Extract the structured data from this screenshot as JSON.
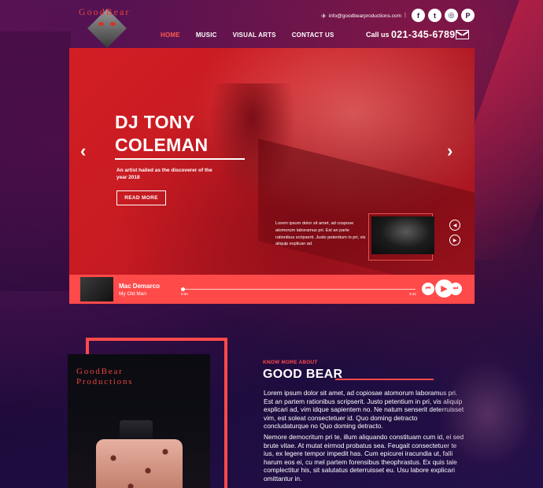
{
  "header": {
    "logo_text": "GoodBear",
    "nav": [
      {
        "label": "HOME",
        "active": true
      },
      {
        "label": "MUSIC",
        "active": false
      },
      {
        "label": "VISUAL ARTS",
        "active": false
      },
      {
        "label": "CONTACT US",
        "active": false
      }
    ],
    "email": "info@goodbearproductions.com",
    "divider": "|",
    "socials": [
      {
        "name": "facebook-icon",
        "glyph": "f"
      },
      {
        "name": "twitter-icon",
        "glyph": "t"
      },
      {
        "name": "instagram-icon",
        "glyph": "◎"
      },
      {
        "name": "pinterest-icon",
        "glyph": "P"
      }
    ],
    "call_label": "Call us",
    "phone": "021-345-6789"
  },
  "hero": {
    "title": "DJ TONY COLEMAN",
    "subtitle": "An artist hailed as the discoverer of the year 2018",
    "cta": "READ MORE",
    "lorem": "Lorem ipsum dolor sit amet, ad cospose atomorum laboramus pri. Est an parte rationibus scripserit. Justo petentium in pri, vis aliquip explican ad.",
    "prev_arrow": "‹",
    "next_arrow": "›",
    "slide_prev": "◀",
    "slide_next": "▶"
  },
  "player": {
    "artist": "Mac Demarco",
    "song": "My Old Man",
    "time_start": "0:00",
    "time_end": "3:42",
    "progress": 0,
    "prev_glyph": "⏮",
    "play_glyph": "▶",
    "next_glyph": "⏭"
  },
  "about": {
    "book_line1": "GoodBear",
    "book_line2": "Productions",
    "kicker": "KNOW MORE ABOUT",
    "title": "GOOD BEAR",
    "p1": "Lorem ipsum dolor sit amet, ad copiosae atomorum laboramus pri. Est an partem rationibus scripserit. Justo petentium in pri, vis aliquip explicari ad, vim idque sapientem no. Ne natum senserit deterruisset vim, est soleat consectetuer id. Quo doming detracto concludaturque no Quo doming detracto.",
    "p2": "Nemore democritum pri te, illum aliquando constituam cum id, ei sed brute vitae. At mutat eirmod probatus sea. Feugait consectetuer te ius, ex legere tempor impedit has. Cum epicurei iracundia ut, falli harum eos ei, cu mel partem forensibus theophrastus. Ex quis tale complectitur his, sit salutatus deterruisset eu. Usu labore explicari omittantur in."
  },
  "colors": {
    "accent": "#ff4a4a",
    "hero_red": "#c61a22",
    "background": "#2a0e45"
  }
}
